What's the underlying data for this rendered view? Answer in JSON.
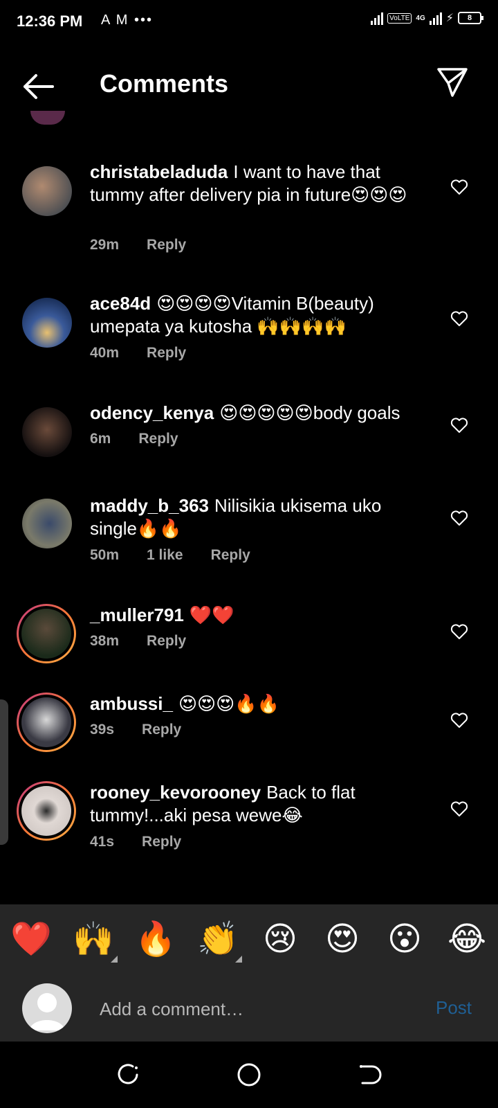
{
  "status": {
    "time": "12:36 PM",
    "notifications": "A M •••",
    "network": "VoLTE",
    "network_gen": "4G",
    "battery": "8"
  },
  "header": {
    "title": "Comments"
  },
  "comments": [
    {
      "username": "christabeladuda",
      "text": "I want to have that tummy after delivery pia in future😍😍😍",
      "time": "29m",
      "likes": "",
      "reply": "Reply",
      "story_ring": false,
      "avatar_color": "#8a6a4a"
    },
    {
      "username": "ace84d",
      "text": "😍😍😍😍Vitamin B(beauty) umepata ya kutosha 🙌🙌🙌🙌",
      "time": "40m",
      "likes": "",
      "reply": "Reply",
      "story_ring": false,
      "avatar_color": "#1e3a6a"
    },
    {
      "username": "odency_kenya",
      "text": "😍😍😍😍😍body goals",
      "time": "6m",
      "likes": "",
      "reply": "Reply",
      "story_ring": false,
      "avatar_color": "#2a1f1f"
    },
    {
      "username": "maddy_b_363",
      "text": "Nilisikia ukisema uko single🔥🔥",
      "time": "50m",
      "likes": "1 like",
      "reply": "Reply",
      "story_ring": false,
      "avatar_color": "#5a6a5a"
    },
    {
      "username": "_muller791",
      "text": "❤️❤️",
      "time": "38m",
      "likes": "",
      "reply": "Reply",
      "story_ring": true,
      "avatar_color": "#2e3a2a"
    },
    {
      "username": "ambussi_",
      "text": "😍😍😍🔥🔥",
      "time": "39s",
      "likes": "",
      "reply": "Reply",
      "story_ring": true,
      "avatar_color": "#4a4a52"
    },
    {
      "username": "rooney_kevorooney",
      "text": "Back to flat tummy!...aki pesa wewe😂",
      "time": "41s",
      "likes": "",
      "reply": "Reply",
      "story_ring": true,
      "avatar_color": "#d8d0cc"
    }
  ],
  "emoji_bar": [
    "❤️",
    "🙌",
    "🔥",
    "👏",
    "😢",
    "😍",
    "😮",
    "😂"
  ],
  "composer": {
    "placeholder": "Add a comment…",
    "post_label": "Post"
  },
  "colors": {
    "accent_post": "#1f5f94",
    "background": "#000000",
    "panel": "#262626",
    "meta_text": "#a8a8a8"
  }
}
